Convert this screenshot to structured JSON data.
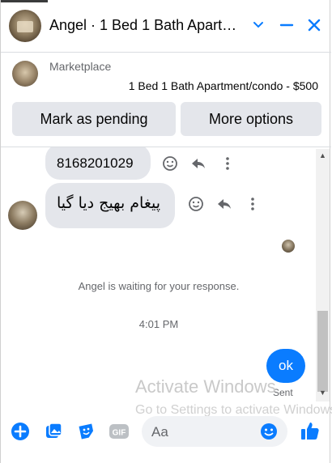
{
  "header": {
    "title": "Angel · 1 Bed 1 Bath Apart…",
    "icons": [
      "chevron-down-icon",
      "minimize-icon",
      "close-icon"
    ]
  },
  "marketplace": {
    "label": "Marketplace",
    "listing": "1 Bed 1 Bath Apartment/condo - $500"
  },
  "actions": {
    "pending_label": "Mark as pending",
    "more_label": "More options"
  },
  "messages": {
    "phone": "8168201029",
    "urdu": "پیغام بھیج دیا گیا",
    "waiting_notice": "Angel is waiting for your response.",
    "timestamp": "4:01 PM",
    "outgoing": "ok",
    "outgoing_status": "Sent"
  },
  "watermark": {
    "line1": "Activate Windows",
    "line2": "Go to Settings to activate Windows."
  },
  "composer": {
    "placeholder": "Aa"
  },
  "colors": {
    "accent": "#0a7cff",
    "bubble_gray": "#e4e6eb"
  }
}
